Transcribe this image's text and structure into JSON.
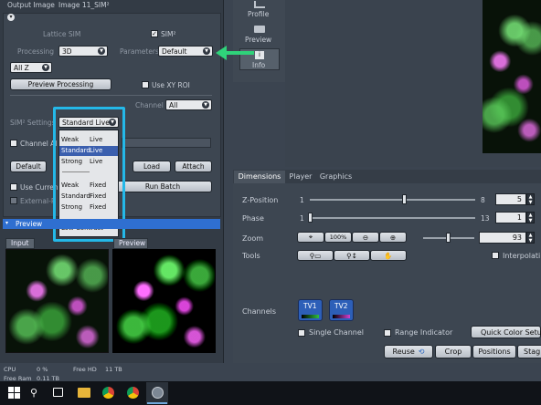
{
  "left_panel": {
    "output_image_label": "Output Image",
    "output_image_value": "Image 11_SIM²",
    "lattice_sim_label": "Lattice SIM",
    "sim2_checkbox_label": "SIM²",
    "sim2_checked": "✓",
    "processing_label": "Processing",
    "processing_value": "3D",
    "parameters_label": "Parameters",
    "parameters_value": "Default",
    "z_range_value": "All Z",
    "preview_processing_button": "Preview Processing",
    "use_xy_roi_label": "Use XY ROI",
    "channel_label": "Channel",
    "channel_value": "All",
    "sim2_settings_label": "SIM² Settings",
    "sim2_settings_value": "Standard Live",
    "channel_all_label": "Channel Al",
    "default_button": "Default",
    "load_button": "Load",
    "attach_button": "Attach",
    "use_current_label": "Use Curren",
    "external_label": "External-P",
    "run_batch_button": "Run Batch"
  },
  "dropdown": {
    "items": [
      {
        "strength": "Weak",
        "mode": "Live"
      },
      {
        "strength": "Standard",
        "mode": "Live"
      },
      {
        "strength": "Strong",
        "mode": "Live"
      },
      {
        "strength": "Weak",
        "mode": "Fixed"
      },
      {
        "strength": "Standard",
        "mode": "Fixed"
      },
      {
        "strength": "Strong",
        "mode": "Fixed"
      },
      {
        "strength": "Low Contrast",
        "mode": ""
      }
    ],
    "selected_index": 1
  },
  "preview": {
    "header": "Preview",
    "input_tab": "Input",
    "preview_tab": "Preview"
  },
  "status_bar": {
    "cpu_label": "CPU",
    "cpu_value": "0 %",
    "free_hd_label": "Free HD",
    "free_hd_value": "11 TB",
    "free_ram_label": "Free Ram",
    "free_ram_value": "0.11 TB"
  },
  "view_tabs": {
    "profile": "Profile",
    "preview": "Preview",
    "info": "Info"
  },
  "dimensions": {
    "tabs": [
      "Dimensions",
      "Player",
      "Graphics"
    ],
    "z_position_label": "Z-Position",
    "z_min": "1",
    "z_max": "8",
    "z_value": "5",
    "z_fraction": 0.57,
    "phase_label": "Phase",
    "phase_min": "1",
    "phase_max": "13",
    "phase_value": "1",
    "phase_fraction": 0.0,
    "zoom_label": "Zoom",
    "zoom_100_label": "100%",
    "zoom_value": "93",
    "tools_label": "Tools",
    "interpolation_label": "Interpolati",
    "channels_label": "Channels",
    "channel_1": "TV1",
    "channel_2": "TV2",
    "single_channel_label": "Single Channel",
    "range_indicator_label": "Range Indicator",
    "quick_color_setup": "Quick Color Setu",
    "reuse_button": "Reuse",
    "crop_button": "Crop",
    "positions_button": "Positions",
    "stage_button": "Stag"
  },
  "colors": {
    "callout_box": "#24b8e8",
    "arrow": "#2fd27a",
    "preview_header": "#2f6fd0",
    "tv1_color": "#2fbf3f",
    "tv2_color": "#d040d0"
  },
  "icons": [
    "collapse-icon",
    "profile-icon",
    "preview-icon",
    "info-icon",
    "search-icon",
    "task-view-icon",
    "file-explorer-icon",
    "chrome-icon",
    "zen-icon",
    "crosshair-icon",
    "zoom-out-icon",
    "zoom-in-icon",
    "zoom-rect-icon",
    "zoom-pan-icon",
    "hand-icon",
    "reuse-icon"
  ]
}
